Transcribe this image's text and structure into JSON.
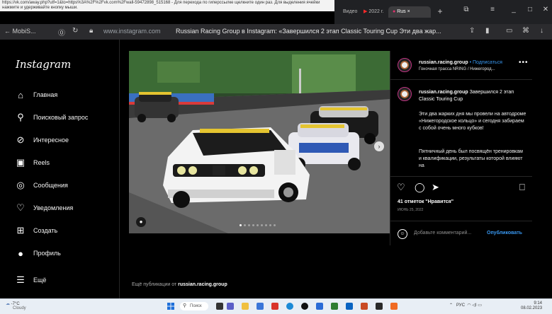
{
  "url_tooltip": "https://vk.com/away.php?utf=1&to=https%3A%2F%2Fvk.com%2Fwall-59472898_515168 - Для перехода по гиперссылке щелкните один раз. Для выделения ячейки нажмите и удерживайте кнопку мыши.",
  "tabs": [
    {
      "label": "Видео"
    },
    {
      "label": "2022 г."
    },
    {
      "label": "Rus ×"
    }
  ],
  "browser": {
    "back_label": "← MobiS...",
    "url": "www.instagram.com",
    "page_title": "Russian Racing Group в Instagram: «Завершился 2 этап Classic Touring Cup Эти два жар..."
  },
  "sidebar": {
    "logo": "Instagram",
    "items": [
      {
        "label": "Главная",
        "icon": "home-icon",
        "glyph": "⌂"
      },
      {
        "label": "Поисковый запрос",
        "icon": "search-icon",
        "glyph": "⚲"
      },
      {
        "label": "Интересное",
        "icon": "compass-icon",
        "glyph": "⊘"
      },
      {
        "label": "Reels",
        "icon": "reels-icon",
        "glyph": "▣"
      },
      {
        "label": "Сообщения",
        "icon": "messenger-icon",
        "glyph": "◎"
      },
      {
        "label": "Уведомления",
        "icon": "heart-icon",
        "glyph": "♡"
      },
      {
        "label": "Создать",
        "icon": "create-icon",
        "glyph": "⊞"
      },
      {
        "label": "Профиль",
        "icon": "profile-icon",
        "glyph": "●"
      },
      {
        "label": "Ещё",
        "icon": "menu-icon",
        "glyph": "☰"
      }
    ]
  },
  "post": {
    "username": "russian.racing.group",
    "follow": "• Подписаться",
    "location": "Гоночная трасса NRING / Нижегород...",
    "caption_user": "russian.racing.group",
    "caption_lead": "Завершился 2 этап Classic Touring Cup",
    "caption_p1": "Эти два жарких дня мы провели на автодроме «Нижегородское кольцо» и сегодня забираем с собой очень много кубков!",
    "caption_p2": "Пятничный день был посвящён тренировкам и квалификации, результаты которой влияют на",
    "likes": "41 отметок \"Нравится\"",
    "date": "ИЮНЬ 25, 2022",
    "comment_placeholder": "Добавьте комментарий...",
    "publish": "Опубликовать",
    "more_posts_prefix": "Ещё публикации от",
    "more_posts_user": "russian.racing.group"
  },
  "taskbar": {
    "temp": "-7°C",
    "weather": "Cloudy",
    "search": "Поиск",
    "lang": "РУС",
    "time": "9:14",
    "date": "08.02.2023"
  }
}
